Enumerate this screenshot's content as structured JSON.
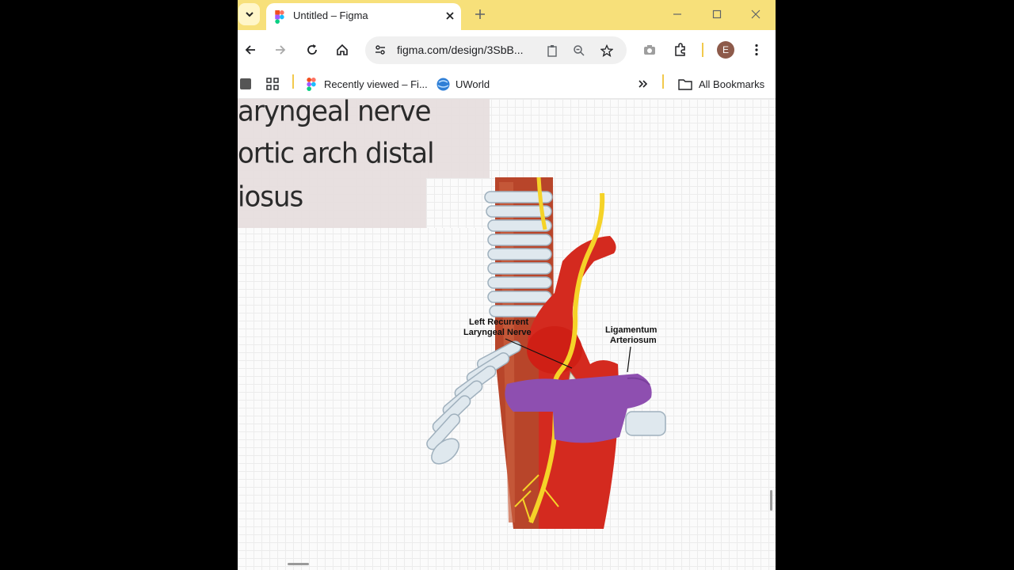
{
  "tab": {
    "title": "Untitled – Figma"
  },
  "toolbar": {
    "url": "figma.com/design/3SbB...",
    "profile_initial": "E"
  },
  "bookmarks": {
    "items": [
      {
        "label": "Recently viewed – Fi..."
      },
      {
        "label": "UWorld"
      }
    ],
    "all_bookmarks": "All Bookmarks"
  },
  "canvas": {
    "note_lines": [
      "aryngeal nerve",
      "ortic arch distal",
      "iosus"
    ],
    "diagram_labels": {
      "left_recurrent": [
        "Left Recurrent",
        "Laryngeal Nerve"
      ],
      "ligamentum": [
        "Ligamentum",
        "Arteriosum"
      ]
    }
  },
  "colors": {
    "titlebar": "#f7e07a",
    "aorta": "#d42a1f",
    "pulmonary_artery": "#8e4fb0",
    "nerve": "#f5d328",
    "trachea": "#dfe8ee",
    "esophagus": "#b8452a"
  }
}
